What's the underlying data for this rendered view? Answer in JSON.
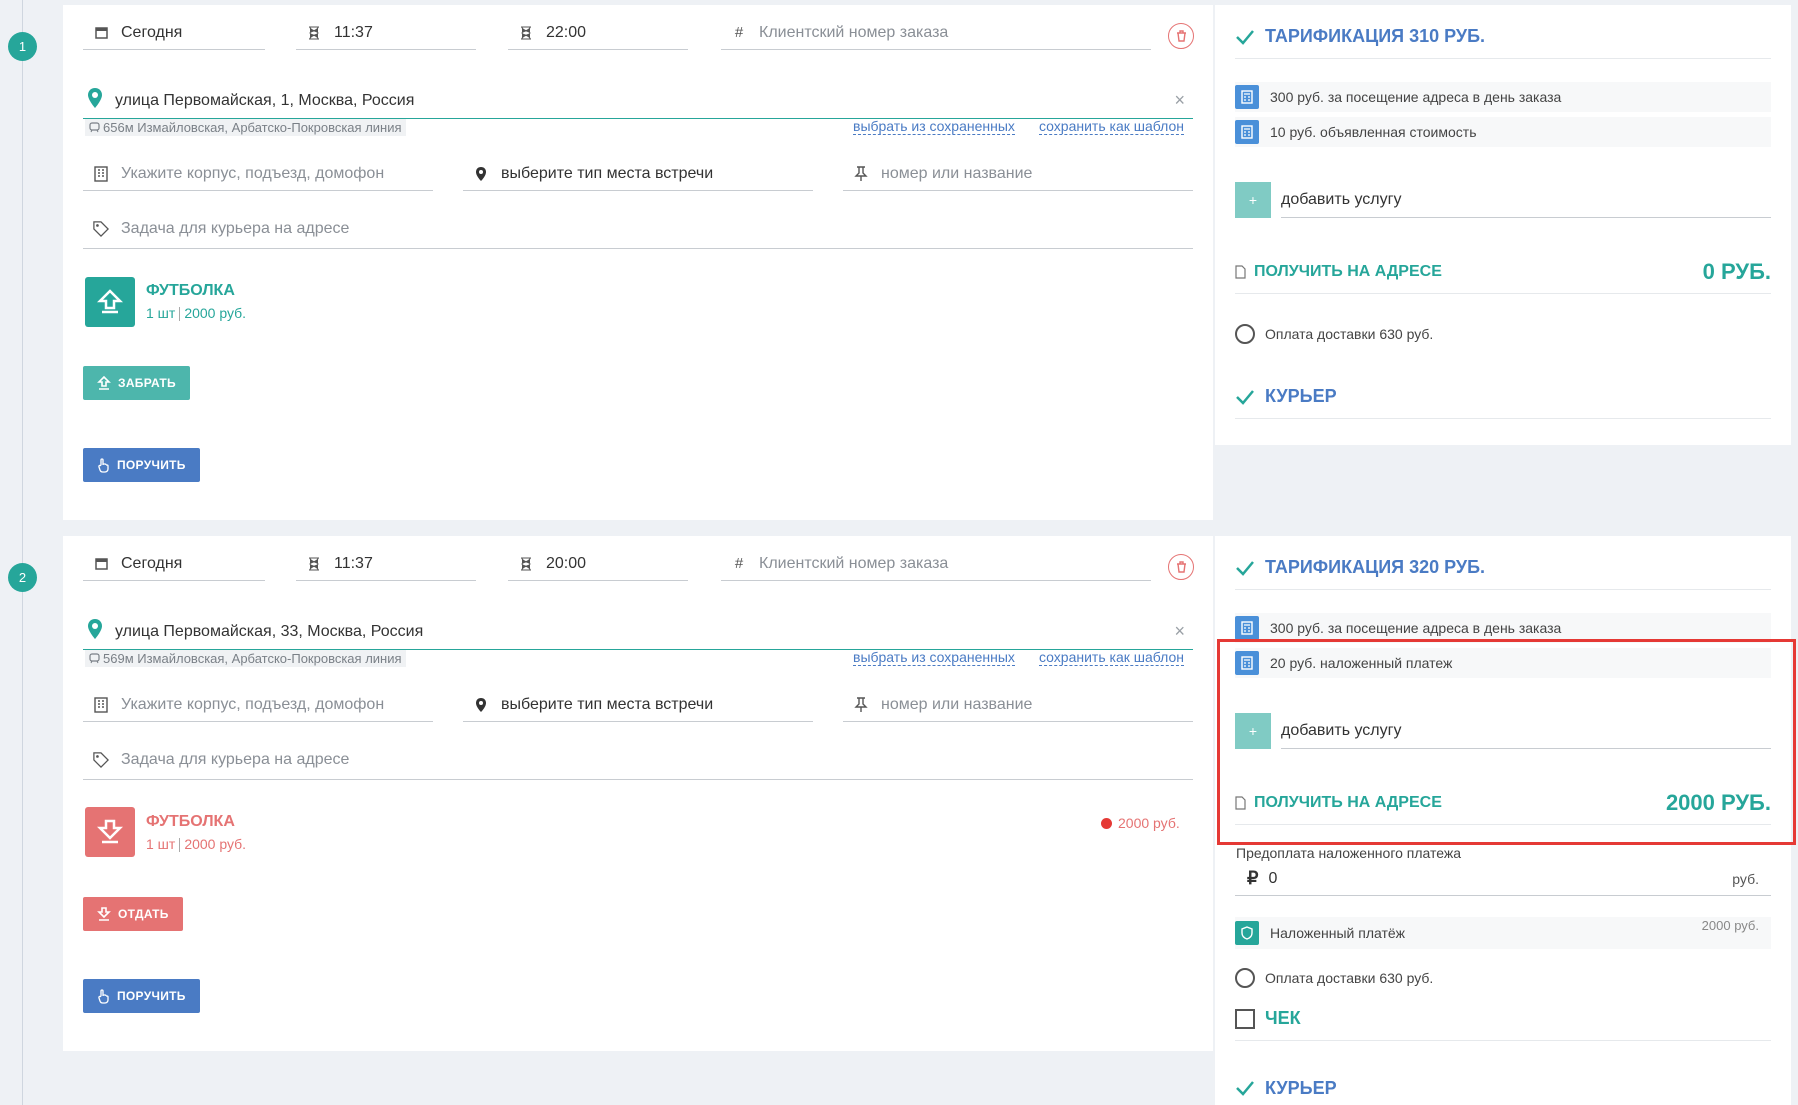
{
  "orders": [
    {
      "step": "1",
      "date": "Сегодня",
      "time_from": "11:37",
      "time_to": "22:00",
      "client_number_placeholder": "Клиентский номер заказа",
      "address": "улица Первомайская, 1, Москва, Россия",
      "metro": "656м Измайловская, Арбатско-Покровская линия",
      "pick_saved": "выбрать из сохраненных",
      "save_template": "сохранить как шаблон",
      "building_placeholder": "Укажите корпус, подъезд, домофон",
      "meeting_type": "выберите тип места встречи",
      "number_placeholder": "номер или название",
      "task_placeholder": "Задача для курьера на адресе",
      "goods_title": "ФУТБОЛКА",
      "goods_qty": "1 шт",
      "goods_price": "2000 руб.",
      "action_button": "ЗАБРАТЬ",
      "assign_button": "ПОРУЧИТЬ"
    },
    {
      "step": "2",
      "date": "Сегодня",
      "time_from": "11:37",
      "time_to": "20:00",
      "client_number_placeholder": "Клиентский номер заказа",
      "address": "улица Первомайская, 33, Москва, Россия",
      "metro": "569м Измайловская, Арбатско-Покровская линия",
      "pick_saved": "выбрать из сохраненных",
      "save_template": "сохранить как шаблон",
      "building_placeholder": "Укажите корпус, подъезд, домофон",
      "meeting_type": "выберите тип места встречи",
      "number_placeholder": "номер или название",
      "task_placeholder": "Задача для курьера на адресе",
      "goods_title": "ФУТБОЛКА",
      "goods_qty": "1 шт",
      "goods_price": "2000 руб.",
      "goods_cod": "2000 руб.",
      "action_button": "ОТДАТЬ",
      "assign_button": "ПОРУЧИТЬ"
    }
  ],
  "tariffs": [
    {
      "title": "ТАРИФИКАЦИЯ 310 РУБ.",
      "services": [
        "300 руб. за посещение адреса в день заказа",
        "10 руб. объявленная стоимость"
      ],
      "add_service": "добавить услугу",
      "get_label": "ПОЛУЧИТЬ НА АДРЕСЕ",
      "get_amount": "0 РУБ.",
      "delivery_payment": "Оплата доставки 630 руб.",
      "courier": "КУРЬЕР"
    },
    {
      "title": "ТАРИФИКАЦИЯ 320 РУБ.",
      "services": [
        "300 руб. за посещение адреса в день заказа",
        "20 руб. наложенный платеж"
      ],
      "add_service": "добавить услугу",
      "get_label": "ПОЛУЧИТЬ НА АДРЕСЕ",
      "get_amount": "2000 РУБ.",
      "prepay_label": "Предоплата наложенного платежа",
      "prepay_value": "0",
      "prepay_unit": "руб.",
      "cod_label": "Наложенный платёж",
      "cod_amount": "2000 руб.",
      "delivery_payment": "Оплата доставки 630 руб.",
      "receipt": "ЧЕК",
      "courier": "КУРЬЕР"
    }
  ],
  "colors": {
    "teal": "#26a69a",
    "blue": "#4a7bc4",
    "red": "#e57373",
    "highlight": "#e53935"
  }
}
